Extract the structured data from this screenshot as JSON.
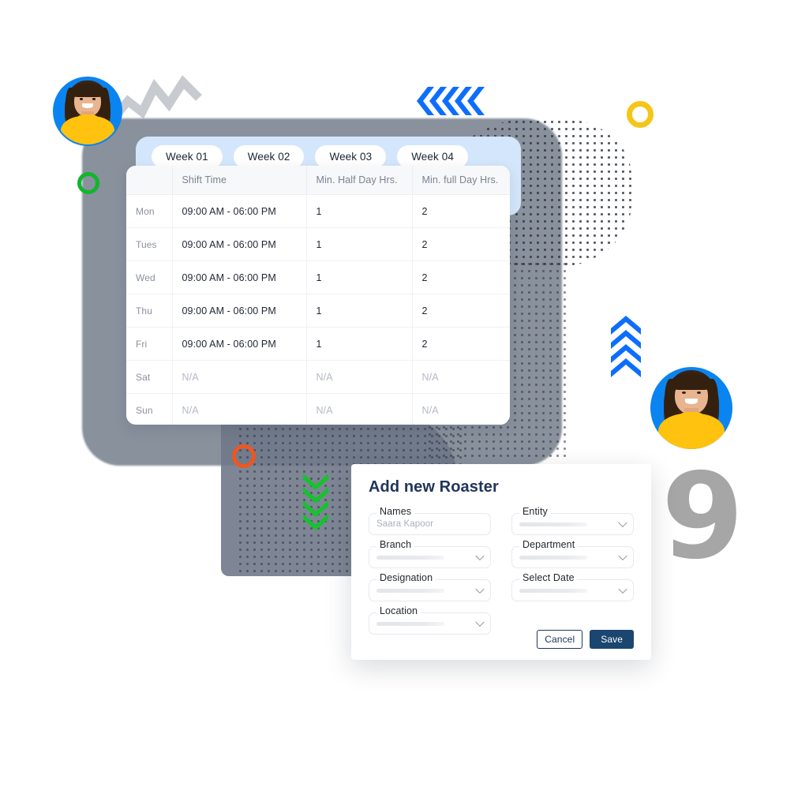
{
  "tabs": {
    "items": [
      {
        "label": "Week 01",
        "active": true
      },
      {
        "label": "Week 02",
        "active": false
      },
      {
        "label": "Week 03",
        "active": false
      },
      {
        "label": "Week 04",
        "active": false
      }
    ]
  },
  "schedule_table": {
    "columns": [
      "",
      "Shift Time",
      "Min. Half Day Hrs.",
      "Min. full Day Hrs."
    ],
    "rows": [
      {
        "day": "Mon",
        "shift_time": "09:00 AM - 06:00 PM",
        "min_half_day": "1",
        "min_full_day": "2"
      },
      {
        "day": "Tues",
        "shift_time": "09:00 AM - 06:00 PM",
        "min_half_day": "1",
        "min_full_day": "2"
      },
      {
        "day": "Wed",
        "shift_time": "09:00 AM - 06:00 PM",
        "min_half_day": "1",
        "min_full_day": "2"
      },
      {
        "day": "Thu",
        "shift_time": "09:00 AM - 06:00 PM",
        "min_half_day": "1",
        "min_full_day": "2"
      },
      {
        "day": "Fri",
        "shift_time": "09:00 AM - 06:00 PM",
        "min_half_day": "1",
        "min_full_day": "2"
      },
      {
        "day": "Sat",
        "shift_time": "N/A",
        "min_half_day": "N/A",
        "min_full_day": "N/A"
      },
      {
        "day": "Sun",
        "shift_time": "N/A",
        "min_half_day": "N/A",
        "min_full_day": "N/A"
      }
    ]
  },
  "modal": {
    "title": "Add new Roaster",
    "fields": {
      "names": {
        "label": "Names",
        "value": "Saara Kapoor",
        "type": "text"
      },
      "entity": {
        "label": "Entity",
        "value": "",
        "type": "select"
      },
      "branch": {
        "label": "Branch",
        "value": "",
        "type": "select"
      },
      "department": {
        "label": "Department",
        "value": "",
        "type": "select"
      },
      "designation": {
        "label": "Designation",
        "value": "",
        "type": "select"
      },
      "select_date": {
        "label": "Select Date",
        "value": "",
        "type": "select"
      },
      "location": {
        "label": "Location",
        "value": "",
        "type": "select"
      }
    },
    "cancel_label": "Cancel",
    "save_label": "Save"
  },
  "decorations": {
    "glyph_nine": "9",
    "colors": {
      "accent_blue": "#0a84f0",
      "tab_panel_blue": "#d4e6fb",
      "save_navy": "#1b4670",
      "title_navy": "#20355c",
      "chevron_blue": "#0d6efd",
      "chevron_green": "#16c22e",
      "ring_orange": "#ec5722",
      "ring_yellow": "#f5c518",
      "ring_green": "#12b52e",
      "sweater_yellow": "#ffc20e",
      "backdrop_grey": "#7f8895"
    }
  }
}
